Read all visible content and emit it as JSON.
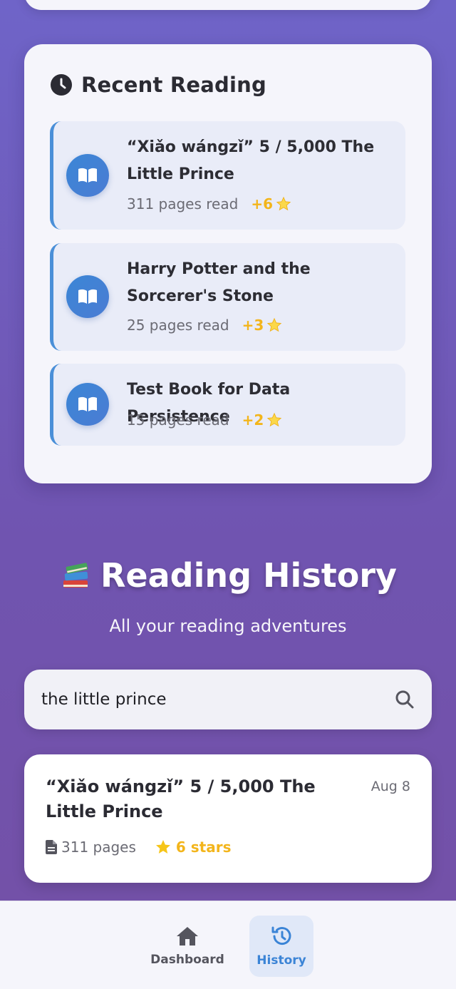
{
  "recent": {
    "title": "Recent Reading",
    "entries": [
      {
        "title": "“Xiǎo wángzǐ” 5 / 5,000 The Little Prince",
        "pages": "311 pages read",
        "stars": "+6"
      },
      {
        "title": "Harry Potter and the Sorcerer's Stone",
        "pages": "25 pages read",
        "stars": "+3"
      },
      {
        "title": "Test Book for Data Persistence",
        "pages": "15 pages read",
        "stars": "+2"
      }
    ]
  },
  "history": {
    "title": "Reading History",
    "subtitle": "All your reading adventures",
    "emoji_icon": "books-icon"
  },
  "search": {
    "value": "the little prince",
    "icon": "search-icon"
  },
  "results": [
    {
      "title": "“Xiǎo wángzǐ” 5 / 5,000 The Little Prince",
      "date": "Aug 8",
      "pages": "311 pages",
      "stars": "6 stars"
    }
  ],
  "nav": {
    "items": [
      {
        "label": "Dashboard",
        "icon": "home-icon",
        "active": false
      },
      {
        "label": "History",
        "icon": "history-icon",
        "active": true
      }
    ]
  },
  "colors": {
    "accent": "#3b84d6",
    "star": "#f3b51b",
    "background": "#7054b0"
  }
}
